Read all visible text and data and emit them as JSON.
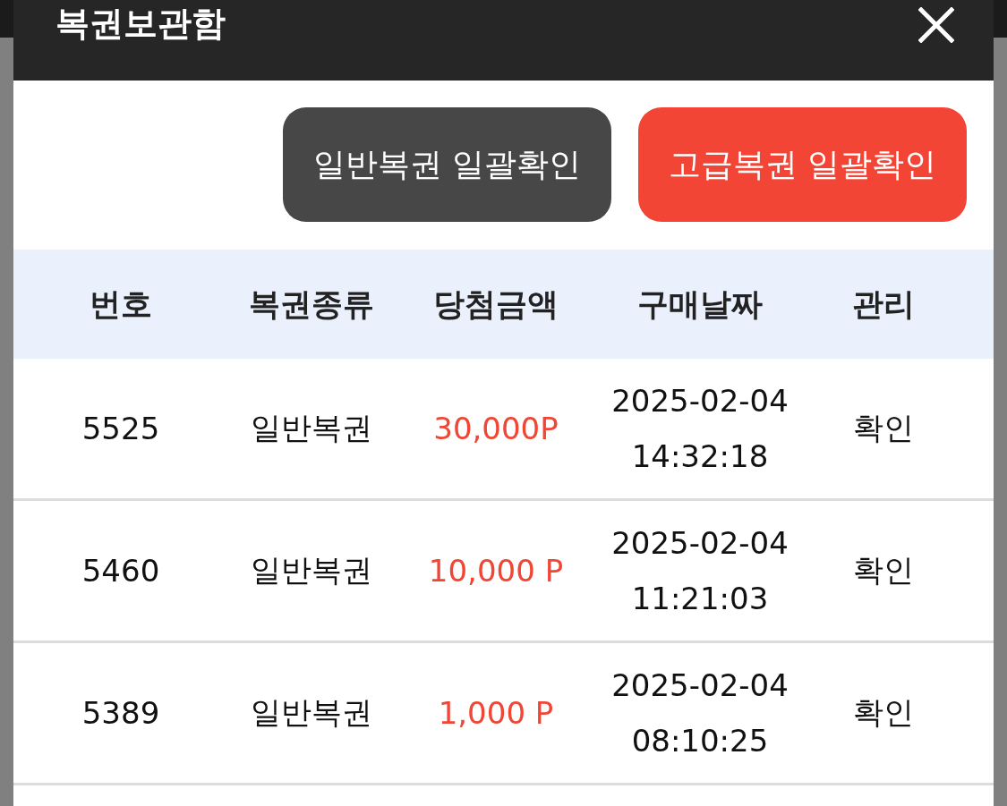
{
  "modal": {
    "title": "복권보관함"
  },
  "actions": [
    {
      "label": "일반복권 일괄확인",
      "kind": "normal"
    },
    {
      "label": "고급복권 일괄확인",
      "kind": "premium"
    }
  ],
  "table": {
    "columns": [
      "번호",
      "복권종류",
      "당첨금액",
      "구매날짜",
      "관리"
    ],
    "rows": [
      {
        "number": "5525",
        "type": "일반복권",
        "amount": "30,000P",
        "purchased": "2025-02-04\n14:32:18",
        "action": "확인"
      },
      {
        "number": "5460",
        "type": "일반복권",
        "amount": "10,000 P",
        "purchased": "2025-02-04\n11:21:03",
        "action": "확인"
      },
      {
        "number": "5389",
        "type": "일반복권",
        "amount": "1,000 P",
        "purchased": "2025-02-04\n08:10:25",
        "action": "확인"
      }
    ]
  }
}
